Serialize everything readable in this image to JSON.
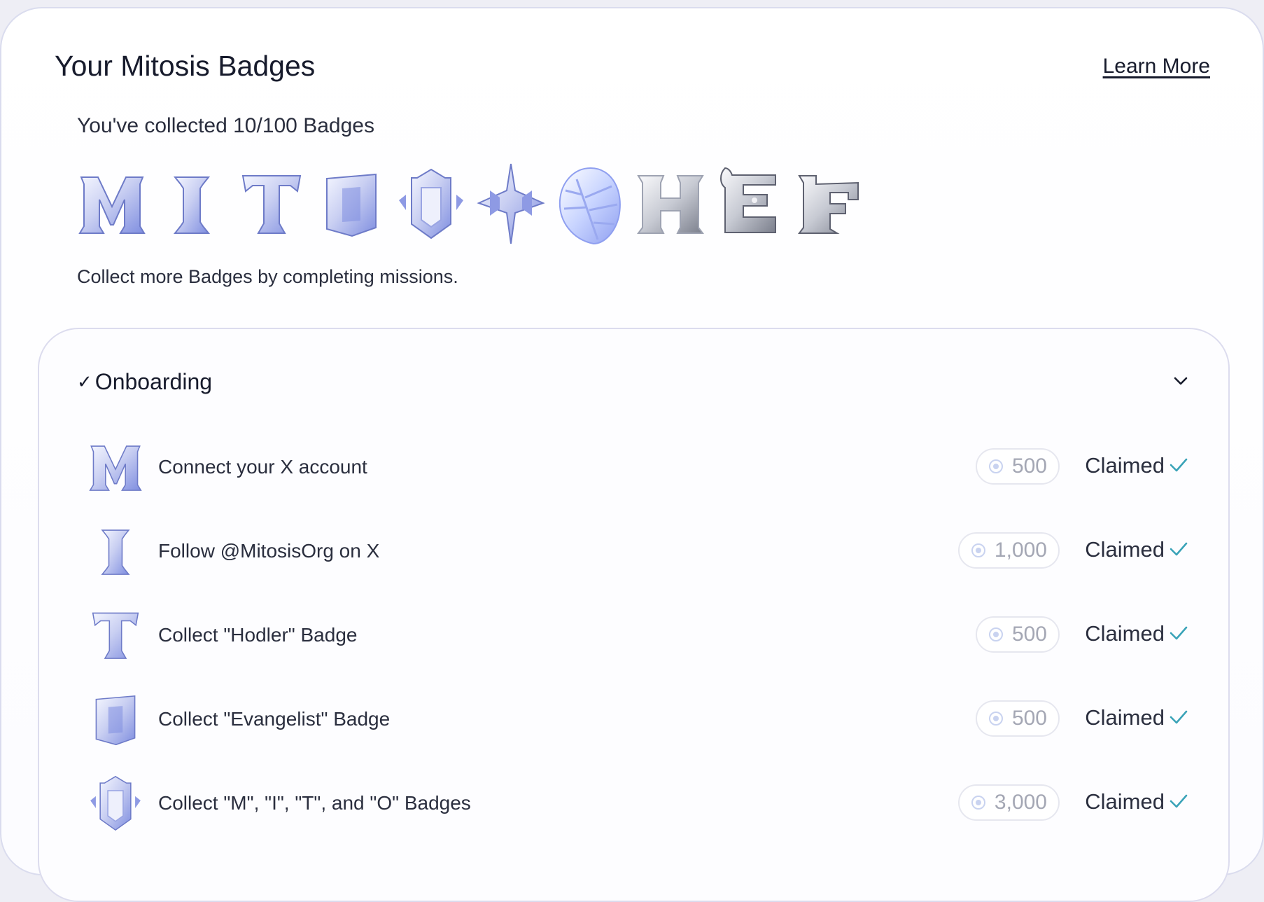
{
  "header": {
    "title": "Your Mitosis Badges",
    "learn_more": "Learn More"
  },
  "collection": {
    "collected_text": "You've collected 10/100 Badges",
    "hint": "Collect more Badges by completing missions.",
    "badges": [
      {
        "name": "badge-m-icon",
        "glyph": "M"
      },
      {
        "name": "badge-i-icon",
        "glyph": "I"
      },
      {
        "name": "badge-t-icon",
        "glyph": "T"
      },
      {
        "name": "badge-o-icon",
        "glyph": "O"
      },
      {
        "name": "badge-shield-icon",
        "glyph": ""
      },
      {
        "name": "badge-star-icon",
        "glyph": ""
      },
      {
        "name": "badge-leaf-icon",
        "glyph": ""
      },
      {
        "name": "badge-h-icon",
        "glyph": "H"
      },
      {
        "name": "badge-e-icon",
        "glyph": "E"
      },
      {
        "name": "badge-f-icon",
        "glyph": "F"
      }
    ]
  },
  "section": {
    "check_glyph": "✓",
    "title": "Onboarding",
    "missions": [
      {
        "icon": "badge-m-icon",
        "label": "Connect your X account",
        "points": "500",
        "status": "Claimed"
      },
      {
        "icon": "badge-i-icon",
        "label": "Follow @MitosisOrg on X",
        "points": "1,000",
        "status": "Claimed"
      },
      {
        "icon": "badge-t-icon",
        "label": "Collect \"Hodler\" Badge",
        "points": "500",
        "status": "Claimed"
      },
      {
        "icon": "badge-o-icon",
        "label": "Collect \"Evangelist\" Badge",
        "points": "500",
        "status": "Claimed"
      },
      {
        "icon": "badge-shield-icon",
        "label": "Collect \"M\", \"I\", \"T\", and \"O\" Badges",
        "points": "3,000",
        "status": "Claimed"
      }
    ]
  },
  "colors": {
    "accent_check": "#3aa3b8",
    "badge_blue": "#7f8ee0",
    "badge_silver": "#9ea3b2"
  }
}
